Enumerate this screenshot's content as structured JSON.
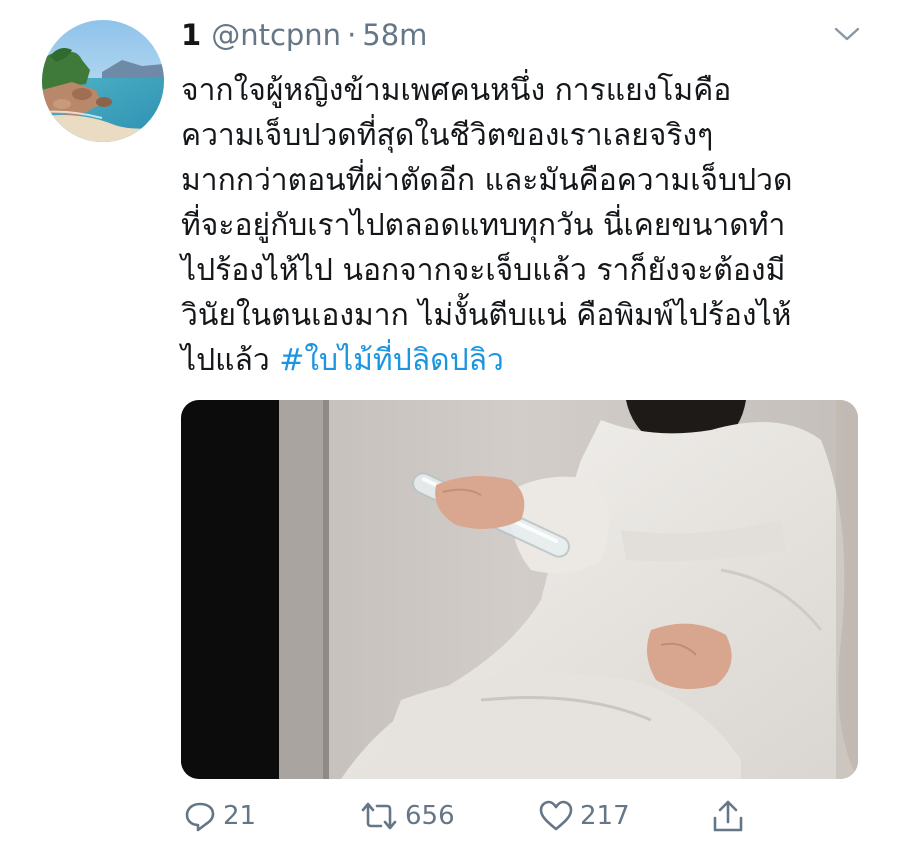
{
  "tweet": {
    "display_name": "1",
    "handle": "@ntcpnn",
    "separator": "·",
    "time": "58m",
    "text_lines": [
      "จากใจผู้หญิงข้ามเพศคนหนึ่ง การแยงโมคือ",
      "ความเจ็บปวดที่สุดในชีวิตของเราเลยจริงๆ",
      "มากกว่าตอนที่ผ่าตัดอีก และมันคือความเจ็บปวด",
      "ที่จะอยู่กับเราไปตลอดแทบทุกวัน นี่เคยขนาดทำ",
      "ไปร้องไห้ไป นอกจากจะเจ็บแล้ว ราก็ยังจะต้องมี",
      "วินัยในตนเองมาก ไม่งั้นตีบแน่ คือพิมพ์ไปร้องไห้"
    ],
    "last_line_prefix": "ไปแล้ว ",
    "hashtag": "#ใบไม้ที่ปลิดปลิว",
    "accent_color": "#1b95e0",
    "icons": {
      "menu": "chevron-down-icon",
      "reply": "reply-icon",
      "retweet": "retweet-icon",
      "like": "heart-icon",
      "share": "share-icon"
    },
    "actions": {
      "replies": "21",
      "retweets": "656",
      "likes": "217"
    }
  }
}
